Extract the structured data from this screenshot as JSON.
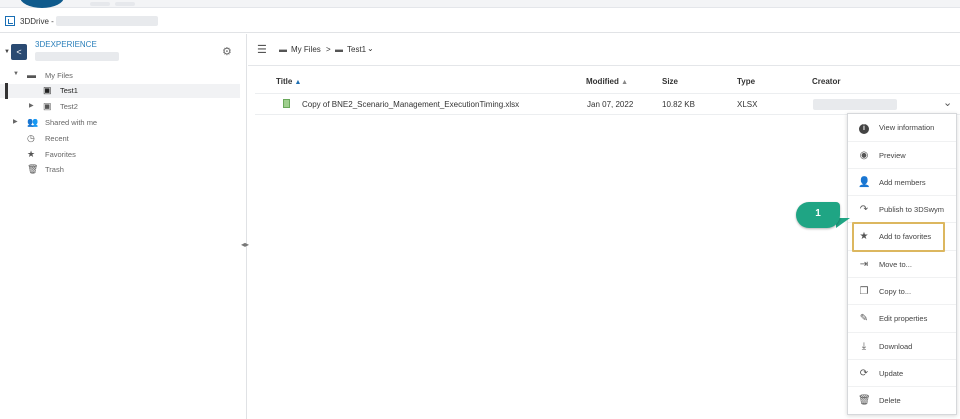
{
  "app": {
    "title": "3DDrive -"
  },
  "workspace": {
    "name": "3DEXPERIENCE"
  },
  "tree": [
    {
      "label": "My Files"
    },
    {
      "label": "Test1"
    },
    {
      "label": "Test2"
    },
    {
      "label": "Shared with me"
    },
    {
      "label": "Recent"
    },
    {
      "label": "Favorites"
    },
    {
      "label": "Trash"
    }
  ],
  "breadcrumb": {
    "root": "My Files",
    "separator": ">",
    "current": "Test1"
  },
  "table": {
    "columns": [
      "Title",
      "Modified",
      "Size",
      "Type",
      "Creator"
    ],
    "rows": [
      {
        "title": "Copy of BNE2_Scenario_Management_ExecutionTiming.xlsx",
        "modified": "Jan 07, 2022",
        "size": "10.82 KB",
        "type": "XLSX"
      }
    ]
  },
  "context_menu": [
    {
      "label": "View information",
      "icon": "info-icon"
    },
    {
      "label": "Preview",
      "icon": "eye-icon"
    },
    {
      "label": "Add members",
      "icon": "add-user-icon"
    },
    {
      "label": "Publish to 3DSwym",
      "icon": "share-icon"
    },
    {
      "label": "Add to favorites",
      "icon": "star-plus-icon"
    },
    {
      "label": "Move to...",
      "icon": "move-icon"
    },
    {
      "label": "Copy to...",
      "icon": "copy-icon"
    },
    {
      "label": "Edit properties",
      "icon": "pencil-icon"
    },
    {
      "label": "Download",
      "icon": "download-icon"
    },
    {
      "label": "Update",
      "icon": "update-icon"
    },
    {
      "label": "Delete",
      "icon": "trash-icon"
    }
  ],
  "callout": {
    "number": "1",
    "color": "#1fa584"
  },
  "colors": {
    "accent": "#2a7fba",
    "highlight": "#dcb75f"
  }
}
